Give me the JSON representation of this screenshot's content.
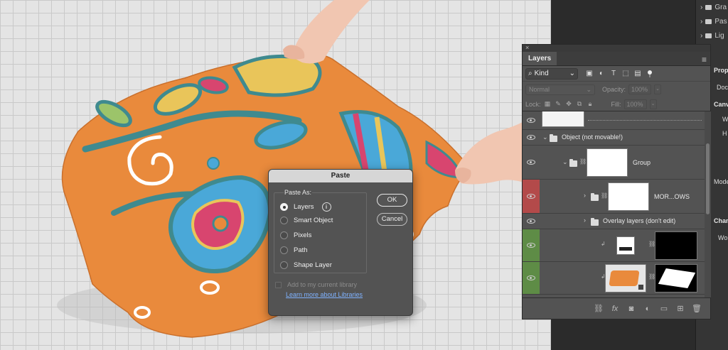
{
  "background_panel": {
    "rows": [
      {
        "label": "Gra",
        "icon": "folder-icon"
      },
      {
        "label": "Pas",
        "icon": "folder-icon"
      },
      {
        "label": "Lig",
        "icon": "folder-icon"
      }
    ],
    "properties_label": "Properties",
    "doc_label": "Doc",
    "canvas_label": "Canva",
    "w_label": "W",
    "h_label": "H",
    "mode_label": "Mode",
    "channels_label": "Channels",
    "channels_item": "Wor"
  },
  "layers_panel": {
    "close_glyph": "×",
    "tab_label": "Layers",
    "filter_kind": "Kind",
    "blend_mode": "Normal",
    "opacity_label": "Opacity:",
    "opacity_value": "100%",
    "lock_label": "Lock:",
    "fill_label": "Fill:",
    "fill_value": "100%",
    "layers": [
      {
        "name": "",
        "type": "pattern"
      },
      {
        "name": "Object (not movable!)",
        "type": "group"
      },
      {
        "name": "Group",
        "type": "group"
      },
      {
        "name": "MOR...OWS",
        "type": "group",
        "label_color": "#b34a4a"
      },
      {
        "name": "Overlay layers (don't edit)",
        "type": "group"
      },
      {
        "name": "",
        "type": "adjustment",
        "label_color": "#5e8c46"
      },
      {
        "name": "",
        "type": "smart-object",
        "label_color": "#5e8c46"
      }
    ],
    "footer_icons": [
      "link-icon",
      "fx-icon",
      "mask-icon",
      "adjustment-icon",
      "folder-icon",
      "new-layer-icon",
      "trash-icon"
    ]
  },
  "paste_dialog": {
    "title": "Paste",
    "group_label": "Paste As:",
    "options": [
      {
        "label": "Layers",
        "selected": true
      },
      {
        "label": "Smart Object",
        "selected": false
      },
      {
        "label": "Pixels",
        "selected": false
      },
      {
        "label": "Path",
        "selected": false
      },
      {
        "label": "Shape Layer",
        "selected": false
      }
    ],
    "ok_label": "OK",
    "cancel_label": "Cancel",
    "library_checkbox_label": "Add to my current library",
    "learn_link": "Learn more about Libraries"
  },
  "colors": {
    "fabric_orange": "#e98a3c",
    "accent_blue": "#4aa8d8",
    "accent_pink": "#d8456f",
    "accent_green": "#9cc46a",
    "ui_dark": "#535353"
  }
}
